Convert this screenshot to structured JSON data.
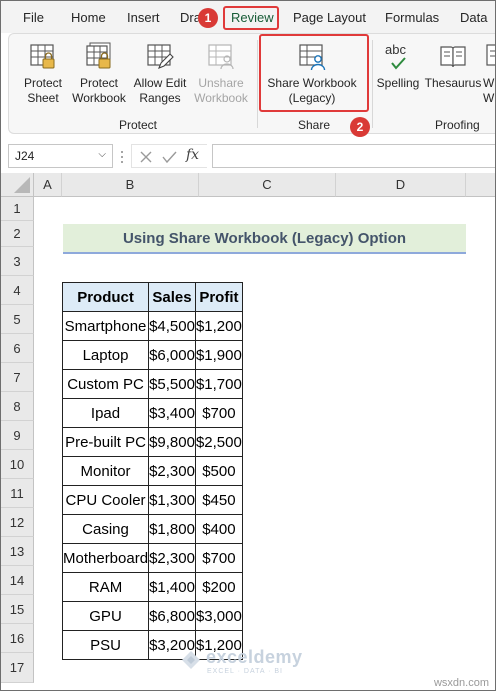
{
  "menu": {
    "tabs": [
      "File",
      "Home",
      "Insert",
      "Dra",
      "Review",
      "Page Layout",
      "Formulas",
      "Data"
    ],
    "active": "Review"
  },
  "markers": [
    "1",
    "2"
  ],
  "ribbon": {
    "protect_group": {
      "label": "Protect",
      "buttons": [
        {
          "line1": "Protect",
          "line2": "Sheet"
        },
        {
          "line1": "Protect",
          "line2": "Workbook"
        },
        {
          "line1": "Allow Edit",
          "line2": "Ranges"
        },
        {
          "line1": "Unshare",
          "line2": "Workbook"
        }
      ]
    },
    "share_group": {
      "label": "Share",
      "button": {
        "line1": "Share Workbook",
        "line2": "(Legacy)"
      }
    },
    "proofing_group": {
      "label": "Proofing",
      "spelling": "Spelling",
      "spelling_icon_text": "abc",
      "thesaurus": "Thesaurus",
      "partial": "W",
      "partial2": "W"
    }
  },
  "formula_bar": {
    "name_box": "J24",
    "fx": "fx",
    "value": ""
  },
  "columns": [
    "A",
    "B",
    "C",
    "D"
  ],
  "rows": [
    "1",
    "2",
    "3",
    "4",
    "5",
    "6",
    "7",
    "8",
    "9",
    "10",
    "11",
    "12",
    "13",
    "14",
    "15",
    "16",
    "17"
  ],
  "sheet": {
    "title": "Using Share Workbook (Legacy) Option",
    "headers": [
      "Product",
      "Sales",
      "Profit"
    ],
    "data": [
      [
        "Smartphone",
        "$4,500",
        "$1,200"
      ],
      [
        "Laptop",
        "$6,000",
        "$1,900"
      ],
      [
        "Custom PC",
        "$5,500",
        "$1,700"
      ],
      [
        "Ipad",
        "$3,400",
        "$700"
      ],
      [
        "Pre-built PC",
        "$9,800",
        "$2,500"
      ],
      [
        "Monitor",
        "$2,300",
        "$500"
      ],
      [
        "CPU Cooler",
        "$1,300",
        "$450"
      ],
      [
        "Casing",
        "$1,800",
        "$400"
      ],
      [
        "Motherboard",
        "$2,300",
        "$700"
      ],
      [
        "RAM",
        "$1,400",
        "$200"
      ],
      [
        "GPU",
        "$6,800",
        "$3,000"
      ],
      [
        "PSU",
        "$3,200",
        "$1,200"
      ]
    ]
  },
  "watermark": {
    "name": "exceldemy",
    "tagline": "EXCEL · DATA · BI"
  },
  "credit": "wsxdn.com",
  "colors": {
    "accent": "#185c37",
    "highlight": "#e03a3a",
    "title_fill": "#e2efda",
    "header_fill": "#ddebf7"
  }
}
